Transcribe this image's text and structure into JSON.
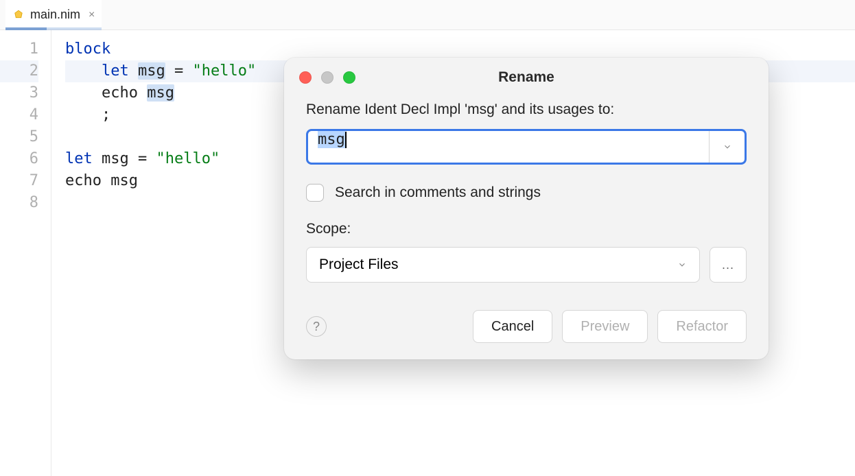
{
  "tab": {
    "filename": "main.nim",
    "close_glyph": "×"
  },
  "editor": {
    "lines": [
      {
        "n": "1",
        "tokens": [
          {
            "t": "block",
            "cls": "kw z"
          }
        ]
      },
      {
        "n": "2",
        "hl": true,
        "tokens": [
          {
            "t": "    ",
            "cls": "z"
          },
          {
            "t": "let",
            "cls": "kw z"
          },
          {
            "t": " ",
            "cls": "z"
          },
          {
            "t": "msg",
            "cls": "sel z"
          },
          {
            "t": " = ",
            "cls": "z"
          },
          {
            "t": "\"hello\"",
            "cls": "str z"
          }
        ]
      },
      {
        "n": "3",
        "tokens": [
          {
            "t": "    echo ",
            "cls": "z"
          },
          {
            "t": "msg",
            "cls": "sel z"
          }
        ]
      },
      {
        "n": "4",
        "tokens": [
          {
            "t": "    ;",
            "cls": "z"
          }
        ]
      },
      {
        "n": "5",
        "tokens": []
      },
      {
        "n": "6",
        "tokens": [
          {
            "t": "let",
            "cls": "kw z"
          },
          {
            "t": " msg = ",
            "cls": "z"
          },
          {
            "t": "\"hello\"",
            "cls": "str z"
          }
        ]
      },
      {
        "n": "7",
        "tokens": [
          {
            "t": "echo msg",
            "cls": "z"
          }
        ]
      },
      {
        "n": "8",
        "tokens": []
      }
    ]
  },
  "dialog": {
    "title": "Rename",
    "prompt": "Rename Ident Decl Impl 'msg' and its usages to:",
    "input_value": "msg",
    "search_comments_label": "Search in comments and strings",
    "search_comments_checked": false,
    "scope_label": "Scope:",
    "scope_value": "Project Files",
    "more_label": "...",
    "help_glyph": "?",
    "buttons": {
      "cancel": "Cancel",
      "preview": "Preview",
      "refactor": "Refactor"
    },
    "preview_enabled": false,
    "refactor_enabled": false
  }
}
